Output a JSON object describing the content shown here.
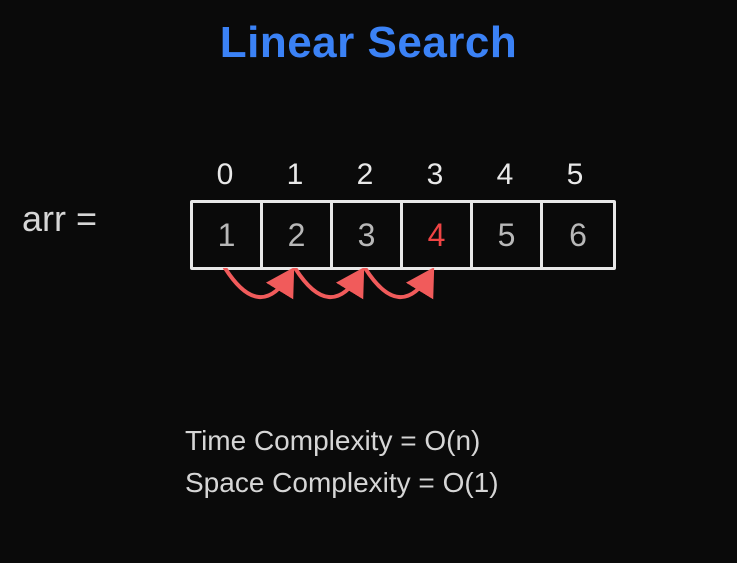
{
  "title": "Linear Search",
  "arr_label": "arr =",
  "indices": [
    "0",
    "1",
    "2",
    "3",
    "4",
    "5"
  ],
  "values": [
    "1",
    "2",
    "3",
    "4",
    "5",
    "6"
  ],
  "target_index": 3,
  "time_complexity": "Time Complexity = O(n)",
  "space_complexity": "Space Complexity = O(1)",
  "colors": {
    "title": "#3b82f6",
    "arrow": "#f15b5b",
    "target": "#ef4444"
  }
}
